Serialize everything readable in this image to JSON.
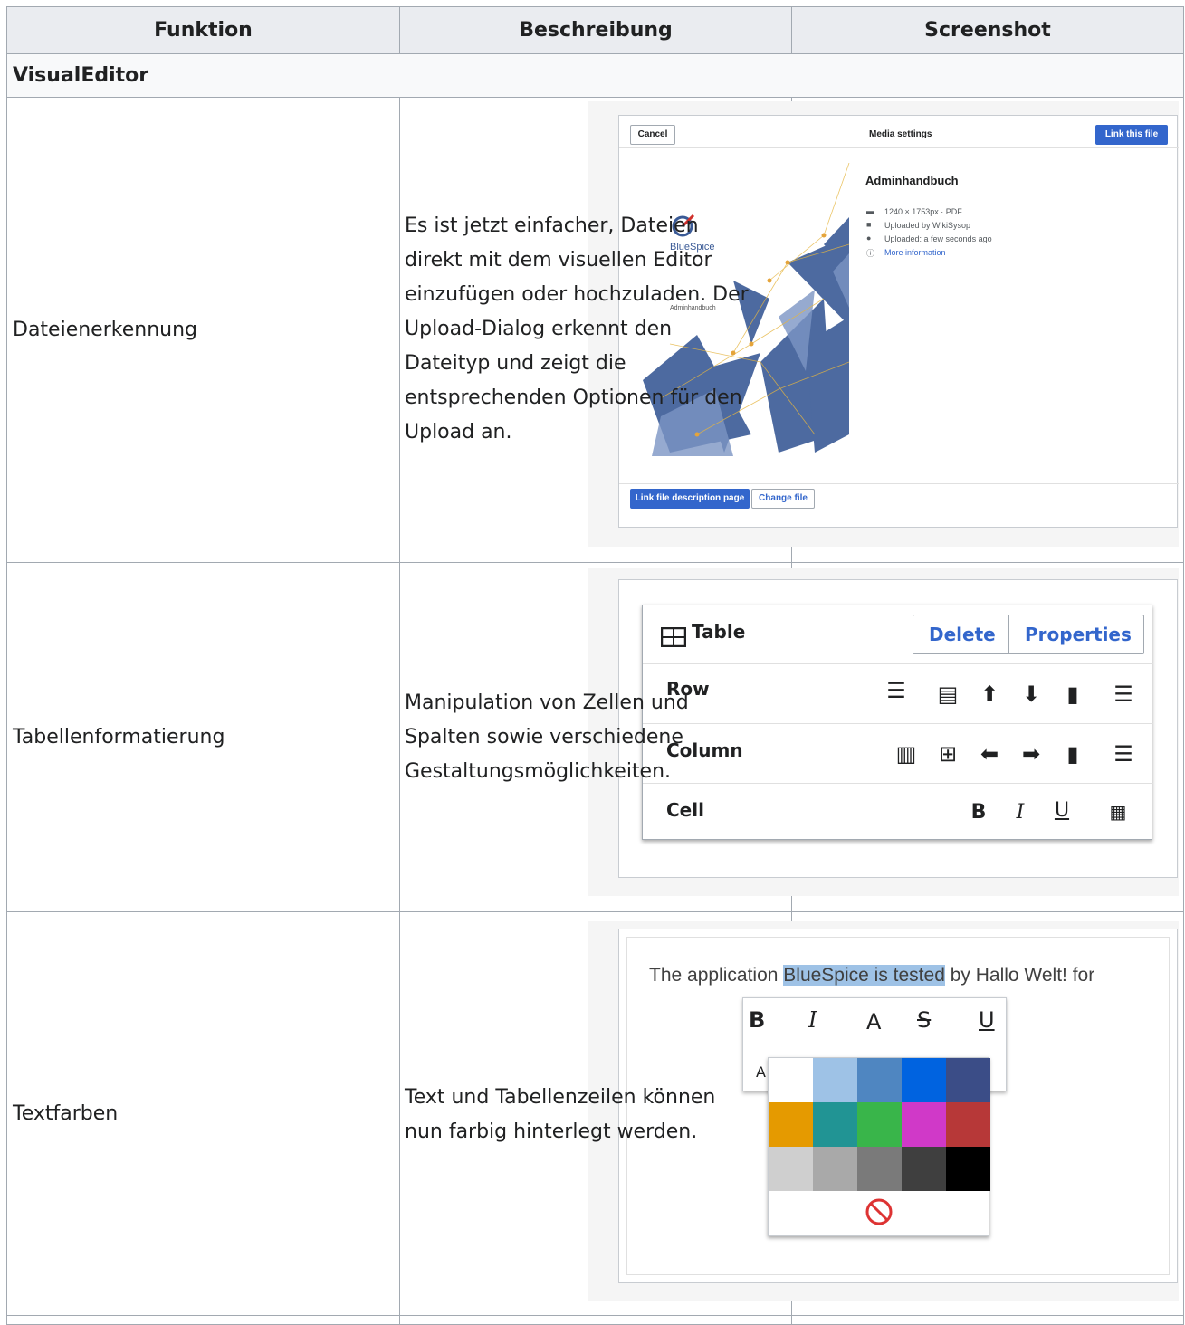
{
  "table": {
    "headers": [
      "Funktion",
      "Beschreibung",
      "Screenshot"
    ],
    "section": "VisualEditor",
    "rows": [
      {
        "funktion": "Dateienerkennung",
        "beschreibung": [
          "Es ist jetzt einfacher, Dateien",
          "direkt mit dem visuellen Editor",
          "einzufügen oder hochzuladen. Der",
          "Upload-Dialog erkennt den",
          "Dateityp und zeigt die",
          "entsprechenden Optionen für den",
          "Upload an."
        ]
      },
      {
        "funktion": "Tabellenformatierung",
        "beschreibung": [
          "Manipulation von Zellen und",
          "Spalten sowie verschiedene",
          "Gestaltungsmöglichkeiten."
        ]
      },
      {
        "funktion": "Textfarben",
        "beschreibung": [
          "Text und Tabellenzeilen können",
          "nun farbig hinterlegt werden."
        ]
      }
    ]
  },
  "shot_media": {
    "cancel": "Cancel",
    "title": "Media settings",
    "link_this_file": "Link this file",
    "file_name": "Adminhandbuch",
    "meta": [
      "1240 × 1753px · PDF",
      "Uploaded by WikiSysop",
      "Uploaded: a few seconds ago",
      "More information"
    ],
    "link_desc": "Link file description page",
    "change_file": "Change file",
    "thumb_brand": "BlueSpice",
    "thumb_caption": "Adminhandbuch"
  },
  "shot_table": {
    "title": "Table",
    "delete": "Delete",
    "properties": "Properties",
    "row": "Row",
    "column": "Column",
    "cell": "Cell",
    "bold": "B",
    "italic": "I",
    "underline": "U"
  },
  "shot_colors": {
    "sentence_before": "The application ",
    "highlight": "BlueSpice is tested",
    "sentence_after": " by Hallo Welt! for",
    "tb_bold": "B",
    "tb_italic": "I",
    "tb_font": "A",
    "tb_strike": "S",
    "tb_under": "U",
    "tb_second": "A",
    "swatches": [
      "#ffffff",
      "#9ec2e6",
      "#4f86c1",
      "#0063e0",
      "#3b4d87",
      "#e59a00",
      "#219494",
      "#39b54a",
      "#d039c8",
      "#b73838",
      "#cfcfcf",
      "#a9a9a9",
      "#7a7a7a",
      "#3f3f3f",
      "#000000"
    ],
    "highlight_color": "#9ec2e6"
  }
}
